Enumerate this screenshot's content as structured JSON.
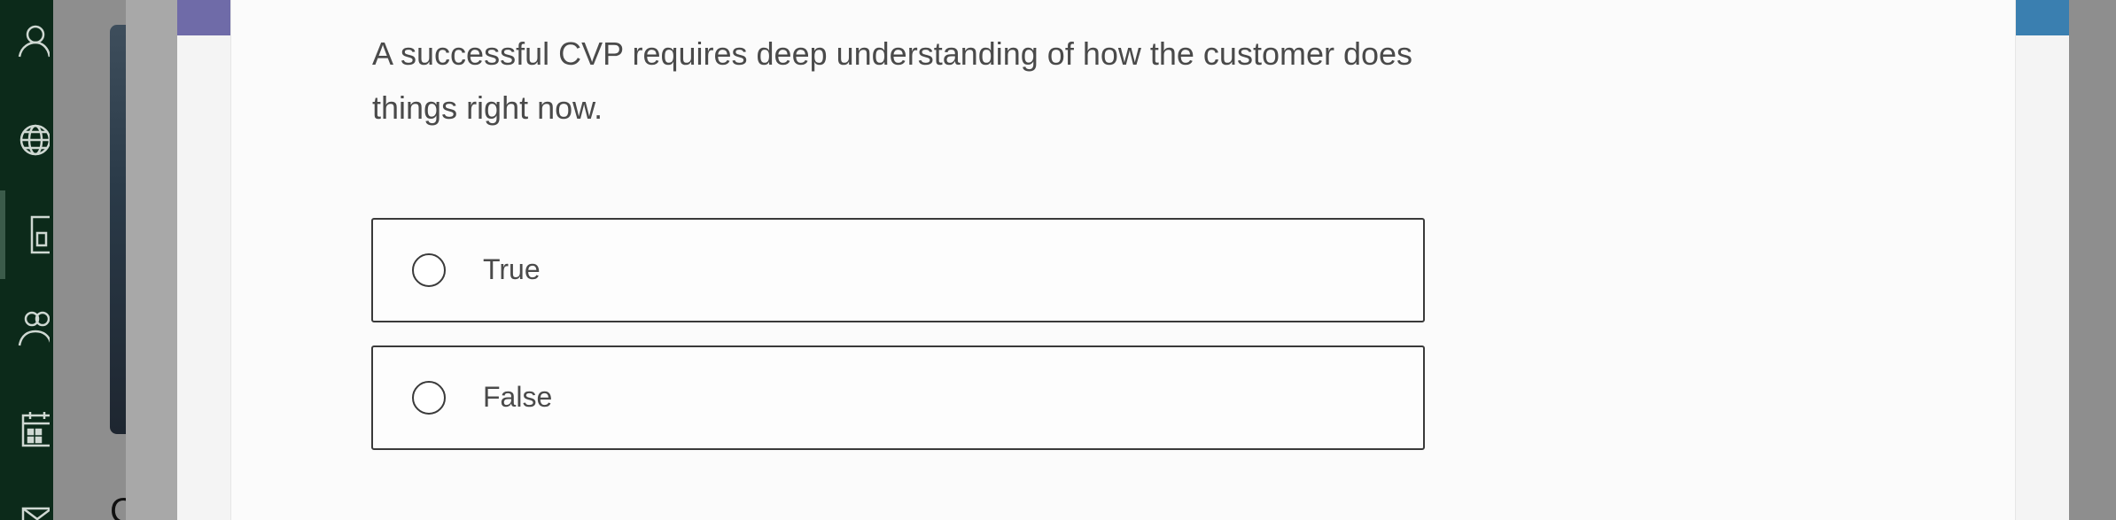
{
  "nav_rail": {
    "icons": [
      "person-icon",
      "globe-icon",
      "gradebook-icon",
      "people-icon",
      "calendar-icon",
      "messages-icon"
    ]
  },
  "question": {
    "text": "A successful CVP requires deep understanding of how the customer does things right now."
  },
  "options": [
    {
      "label": "True",
      "selected": false
    },
    {
      "label": "False",
      "selected": false
    }
  ],
  "colors": {
    "nav_rail": "#0c2a1a",
    "accent_left": "#6f6ba8",
    "accent_right": "#3a7fb0",
    "border": "#3a3a3a",
    "text": "#4a4a4a"
  }
}
